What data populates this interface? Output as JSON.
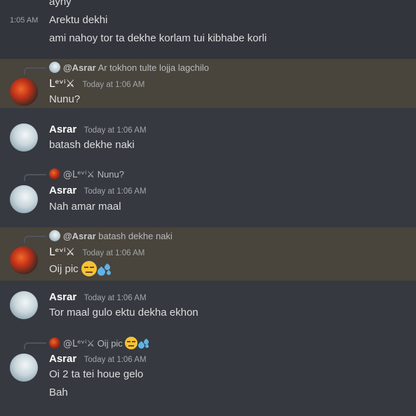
{
  "messages": {
    "top_partial": {
      "text": "ayhy"
    },
    "group0": {
      "timestamp": "1:05 AM",
      "line1": "Arektu dekhi",
      "line2": "ami nahoy tor ta dekhe korlam tui kibhabe korli"
    },
    "m1": {
      "reply_author": "@Asrar",
      "reply_text": "Ar tokhon tulte lojja lagchilo",
      "author": "Lᵉᵛⁱ⚔",
      "time": "Today at 1:06 AM",
      "text": "Nunu?"
    },
    "m2": {
      "author": "Asrar",
      "time": "Today at 1:06 AM",
      "text": "batash dekhe naki"
    },
    "m3": {
      "reply_author": "@Lᵉᵛⁱ⚔",
      "reply_text": "Nunu?",
      "author": "Asrar",
      "time": "Today at 1:06 AM",
      "text": "Nah amar maal"
    },
    "m4": {
      "reply_author": "@Asrar",
      "reply_text": "batash dekhe naki",
      "author": "Lᵉᵛⁱ⚔",
      "time": "Today at 1:06 AM",
      "text": "Oij pic"
    },
    "m5": {
      "author": "Asrar",
      "time": "Today at 1:06 AM",
      "text": "Tor maal gulo ektu dekha ekhon"
    },
    "m6": {
      "reply_author": "@Lᵉᵛⁱ⚔",
      "reply_text": "Oij pic",
      "author": "Asrar",
      "time": "Today at 1:06 AM",
      "line1": "Oi 2 ta tei houe gelo",
      "line2": "Bah"
    }
  },
  "icons": {
    "expressionless": "expressionless-face-emoji",
    "sweat": "sweat-droplets-emoji"
  },
  "colors": {
    "background": "#36393f",
    "mention_highlight": "#49443c",
    "text": "#dcddde",
    "author": "#ffffff",
    "timestamp": "#a3a6aa"
  }
}
